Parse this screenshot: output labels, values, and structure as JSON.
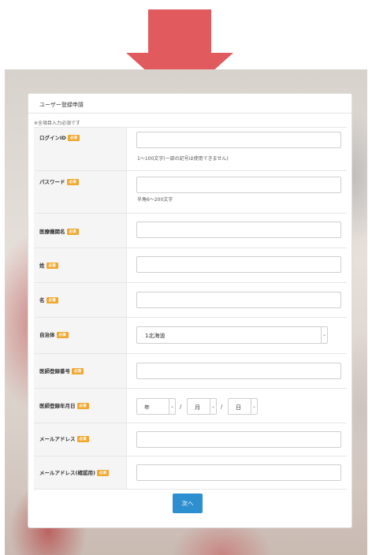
{
  "form": {
    "title": "ユーザー登録申請",
    "note": "※全項目入力必須です",
    "required_badge": "必須",
    "fields": [
      {
        "label": "ログインID",
        "hint": "1～100文字(一部の記号は使用できません)"
      },
      {
        "label": "パスワード",
        "hint": "半角6～200文字"
      },
      {
        "label": "医療機関名"
      },
      {
        "label": "姓"
      },
      {
        "label": "名"
      },
      {
        "label": "自治体",
        "selected": "1北海道"
      },
      {
        "label": "医師登録番号"
      },
      {
        "label": "医師登録年月日",
        "year": "年",
        "month": "月",
        "day": "日",
        "separator": "/"
      },
      {
        "label": "メールアドレス"
      },
      {
        "label": "メールアドレス(確認用)"
      }
    ],
    "next_button": "次へ"
  },
  "colors": {
    "arrow": "#e05a5e",
    "required_badge": "#f0a830",
    "next_button": "#2e8fd0"
  }
}
